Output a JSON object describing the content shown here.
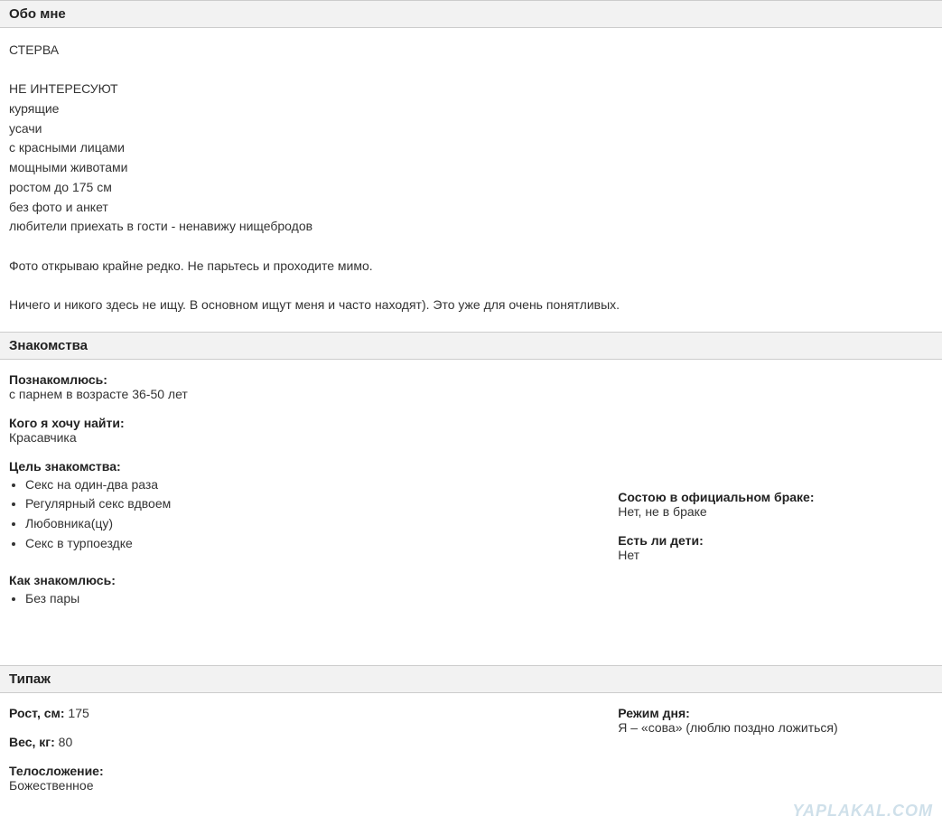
{
  "about": {
    "title": "Обо мне",
    "lines": [
      "СТЕРВА",
      "",
      "НЕ ИНТЕРЕСУЮТ",
      "курящие",
      "усачи",
      "с красными лицами",
      "мощными животами",
      "ростом до 175 см",
      "без фото и анкет",
      "любители приехать в гости - ненавижу нищебродов",
      "",
      "Фото открываю крайне редко. Не парьтесь и проходите мимо.",
      "",
      "Ничего и никого здесь не ищу. В основном ищут меня и часто находят). Это уже для очень понятливых."
    ]
  },
  "dating": {
    "title": "Знакомства",
    "meet": {
      "label": "Познакомлюсь:",
      "value": "с парнем в возрасте 36-50 лет"
    },
    "find": {
      "label": "Кого я хочу найти:",
      "value": "Красавчика"
    },
    "purpose": {
      "label": "Цель знакомства:",
      "items": [
        "Секс на один-два раза",
        "Регулярный секс вдвоем",
        "Любовника(цу)",
        "Секс в турпоездке"
      ]
    },
    "how": {
      "label": "Как знакомлюсь:",
      "items": [
        "Без пары"
      ]
    },
    "marriage": {
      "label": "Состою в официальном браке:",
      "value": "Нет, не в браке"
    },
    "children": {
      "label": "Есть ли дети:",
      "value": "Нет"
    }
  },
  "type": {
    "title": "Типаж",
    "height": {
      "label": "Рост, см:",
      "value": "175"
    },
    "weight": {
      "label": "Вес, кг:",
      "value": "80"
    },
    "build": {
      "label": "Телосложение:",
      "value": "Божественное"
    },
    "routine": {
      "label": "Режим дня:",
      "value": "Я – «сова» (люблю поздно ложиться)"
    }
  },
  "watermark": "YAPLAKAL.COM"
}
